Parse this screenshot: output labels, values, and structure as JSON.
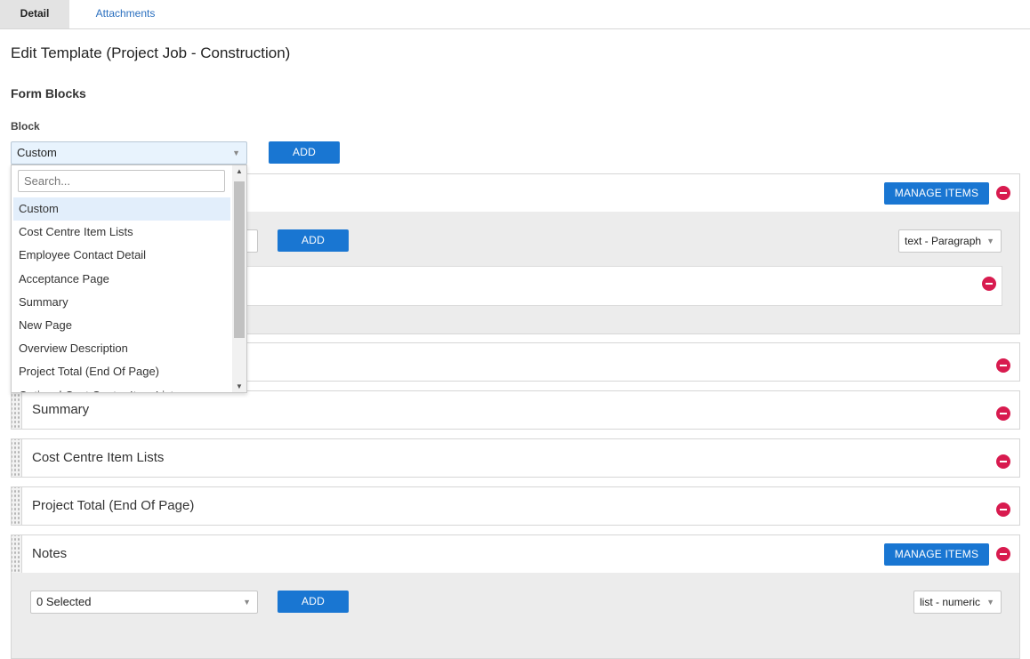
{
  "tabs": [
    {
      "label": "Detail",
      "active": true
    },
    {
      "label": "Attachments",
      "active": false
    }
  ],
  "page": {
    "title": "Edit Template (Project Job - Construction)",
    "section_title": "Form Blocks",
    "block_label": "Block"
  },
  "block_select": {
    "value": "Custom",
    "add_label": "ADD"
  },
  "dropdown": {
    "search_placeholder": "Search...",
    "options": [
      "Custom",
      "Cost Centre Item Lists",
      "Employee Contact Detail",
      "Acceptance Page",
      "Summary",
      "New Page",
      "Overview Description",
      "Project Total (End Of Page)",
      "Optional Cost Centre Item Lists"
    ],
    "selected": "Custom"
  },
  "custom_panel": {
    "manage_label": "MANAGE ITEMS",
    "add_label": "ADD",
    "type_select": "text - Paragraph"
  },
  "panels": [
    {
      "title": "Summary"
    },
    {
      "title": "Cost Centre Item Lists"
    },
    {
      "title": "Project Total (End Of Page)"
    }
  ],
  "notes_panel": {
    "title": "Notes",
    "manage_label": "MANAGE ITEMS",
    "selected_text": "0 Selected",
    "add_label": "ADD",
    "type_select": "list - numeric"
  },
  "colors": {
    "primary": "#1976d2",
    "danger": "#d81b4f",
    "link": "#2a6fbf"
  }
}
